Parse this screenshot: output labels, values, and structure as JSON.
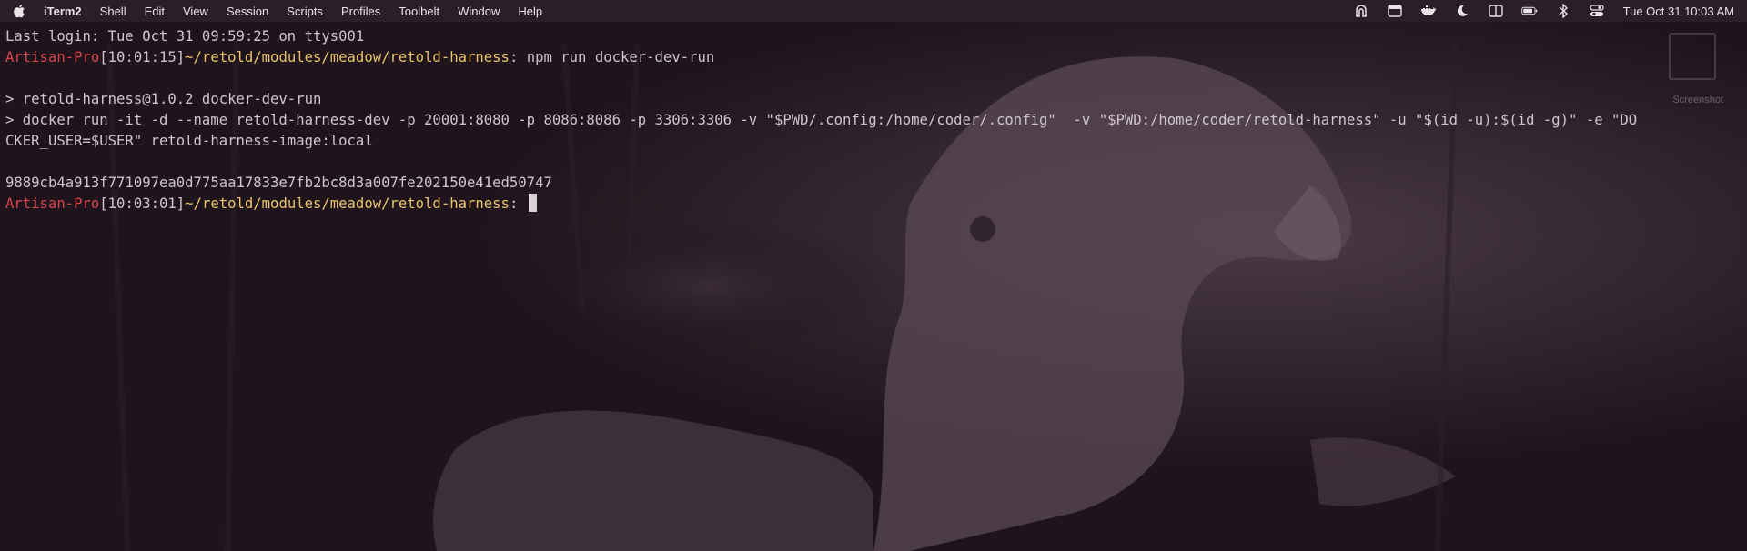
{
  "menubar": {
    "app_name": "iTerm2",
    "items": [
      "Shell",
      "Edit",
      "View",
      "Session",
      "Scripts",
      "Profiles",
      "Toolbelt",
      "Window",
      "Help"
    ],
    "datetime": "Tue Oct 31  10:03 AM",
    "status_icons": [
      "arch-icon",
      "window-icon",
      "docker-icon",
      "moon-icon",
      "display-icon",
      "battery-icon",
      "bluetooth-icon",
      "control-center-icon"
    ]
  },
  "terminal": {
    "last_login": "Last login: Tue Oct 31 09:59:25 on ttys001",
    "prompt1": {
      "host": "Artisan-Pro",
      "time": "[10:01:15]",
      "path": "~/retold/modules/meadow/retold-harness",
      "sep": ": ",
      "command": "npm run docker-dev-run"
    },
    "output": [
      "",
      "> retold-harness@1.0.2 docker-dev-run",
      "> docker run -it -d --name retold-harness-dev -p 20001:8080 -p 8086:8086 -p 3306:3306 -v \"$PWD/.config:/home/coder/.config\"  -v \"$PWD:/home/coder/retold-harness\" -u \"$(id -u):$(id -g)\" -e \"DO",
      "CKER_USER=$USER\" retold-harness-image:local",
      "",
      "9889cb4a913f771097ea0d775aa17833e7fb2bc8d3a007fe202150e41ed50747"
    ],
    "prompt2": {
      "host": "Artisan-Pro",
      "time": "[10:03:01]",
      "path": "~/retold/modules/meadow/retold-harness",
      "sep": ": "
    }
  },
  "thumbnail": {
    "label": "Screenshot"
  },
  "colors": {
    "host": "#d6444c",
    "path": "#e9c46a",
    "text": "#cfc6cc",
    "background": "#1f141b"
  }
}
